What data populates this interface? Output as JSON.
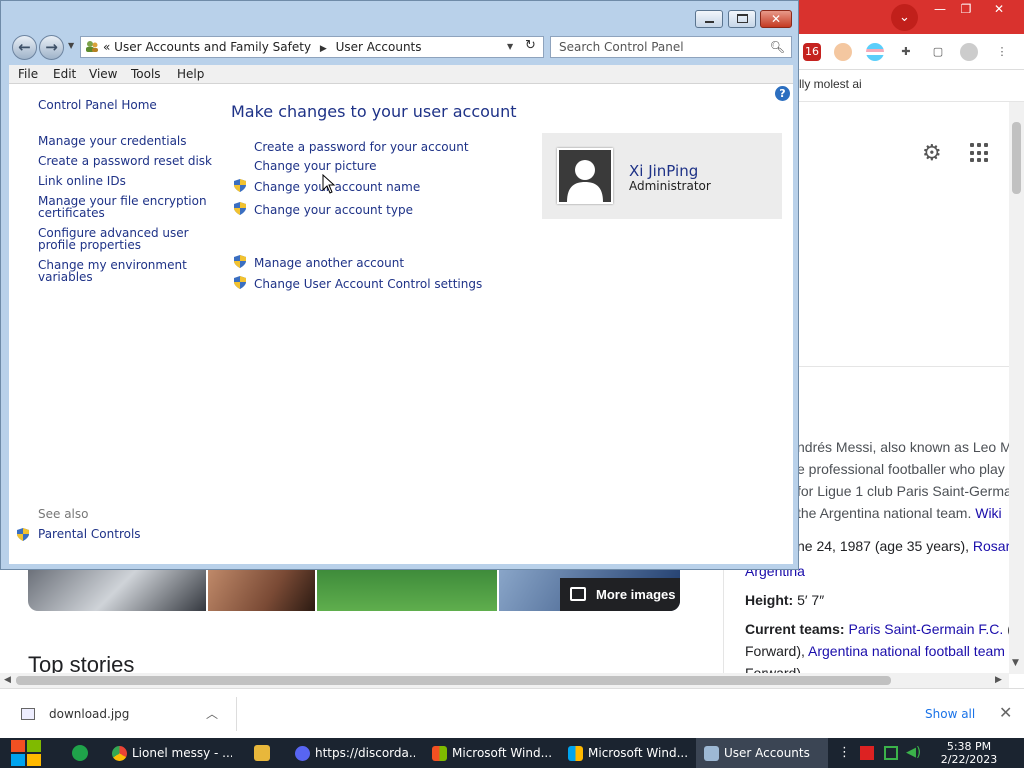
{
  "chrome": {
    "bookmark_text": "lly molest ai",
    "extension_badge": "16",
    "knowledge_panel": {
      "description_lines": [
        "ndrés Messi, also known as Leo M",
        "e professional footballer who play",
        "for Ligue 1 club Paris Saint-Germa",
        "the Argentina national team."
      ],
      "description_link": "Wiki",
      "born_text": "ne 24, 1987 (age 35 years), ",
      "born_link": "Rosari",
      "born_link2": "Argentina",
      "height_label": "Height:",
      "height_value": "5′ 7″",
      "teams_label": "Current teams:",
      "teams_link1": "Paris Saint-Germain F.C.",
      "teams_text1": " (#",
      "teams_text2": "Forward), ",
      "teams_link2": "Argentina national football team",
      "teams_text3": "Forward)"
    },
    "more_images": "More images",
    "top_stories": "Top stories"
  },
  "downloads": {
    "file_name": "download.jpg",
    "show_all": "Show all"
  },
  "taskbar": {
    "tasks": [
      {
        "label": "Lionel messy - ..."
      },
      {
        "label": "https://discorda..."
      },
      {
        "label": "Microsoft Wind..."
      },
      {
        "label": "Microsoft Wind..."
      },
      {
        "label": "User Accounts"
      }
    ],
    "clock_time": "5:38 PM",
    "clock_date": "2/22/2023"
  },
  "control_panel": {
    "address": {
      "prefix": "«",
      "crumb1": "User Accounts and Family Safety",
      "crumb2": "User Accounts"
    },
    "search_placeholder": "Search Control Panel",
    "menu": [
      "File",
      "Edit",
      "View",
      "Tools",
      "Help"
    ],
    "left_links": [
      "Control Panel Home",
      "Manage your credentials",
      "Create a password reset disk",
      "Link online IDs",
      "Manage your file encryption",
      "certificates",
      "Configure advanced user",
      "profile properties",
      "Change my environment",
      "variables"
    ],
    "see_also": "See also",
    "parental_controls": "Parental Controls",
    "heading": "Make changes to your user account",
    "tasks": [
      "Create a password for your account",
      "Change your picture",
      "Change your account name",
      "Change your account type",
      "Manage another account",
      "Change User Account Control settings"
    ],
    "user": {
      "name": "Xi JinPing",
      "role": "Administrator"
    }
  },
  "colors": {
    "link_blue": "#1e3287",
    "chrome_red": "#d9322e",
    "window_frame": "#b9d1ea"
  }
}
